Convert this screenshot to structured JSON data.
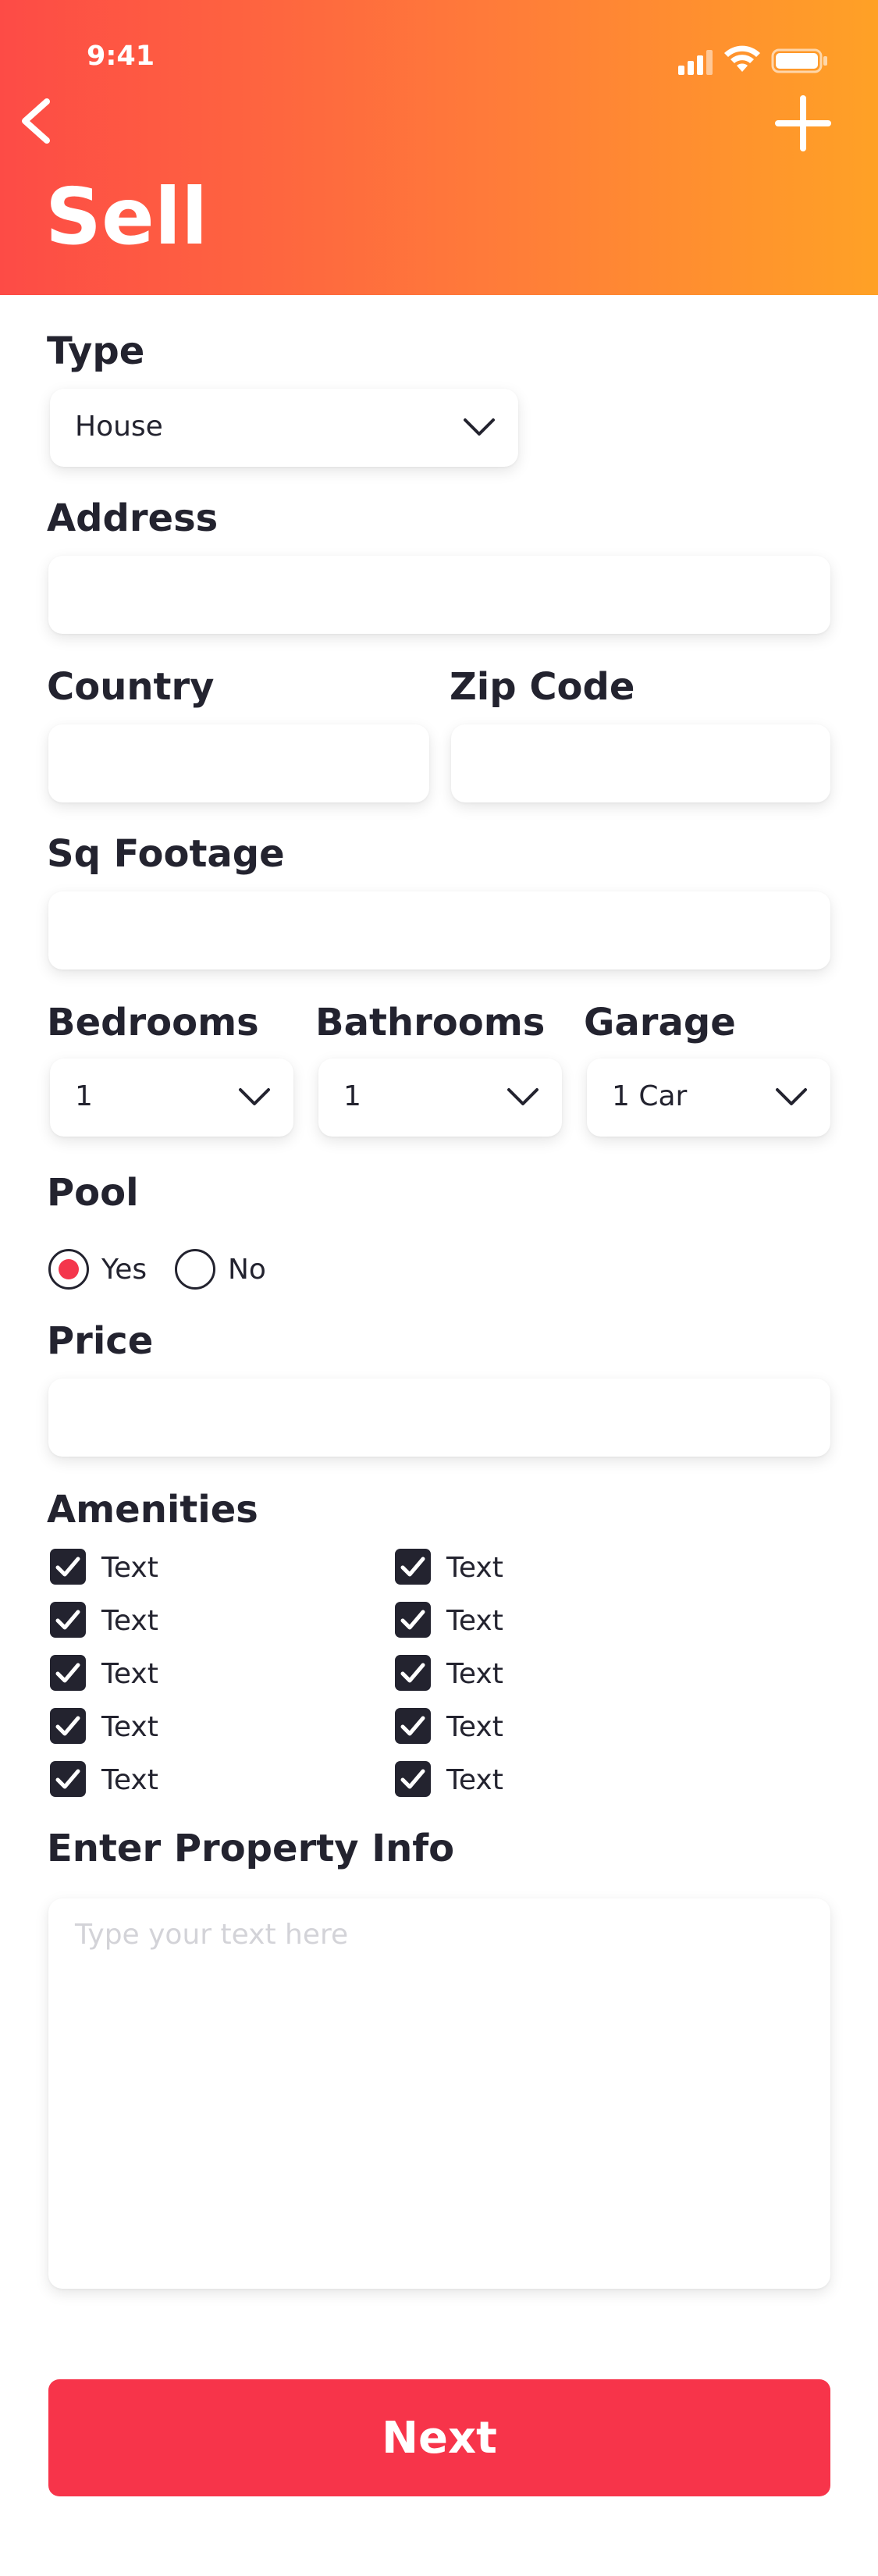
{
  "status_bar": {
    "time": "9:41"
  },
  "header": {
    "title": "Sell"
  },
  "form": {
    "type": {
      "label": "Type",
      "value": "House"
    },
    "address": {
      "label": "Address",
      "value": ""
    },
    "country": {
      "label": "Country",
      "value": ""
    },
    "zip": {
      "label": "Zip Code",
      "value": ""
    },
    "sq_footage": {
      "label": "Sq Footage",
      "value": ""
    },
    "bedrooms": {
      "label": "Bedrooms",
      "value": "1"
    },
    "bathrooms": {
      "label": "Bathrooms",
      "value": "1"
    },
    "garage": {
      "label": "Garage",
      "value": "1 Car"
    },
    "pool": {
      "label": "Pool",
      "options": [
        {
          "label": "Yes",
          "selected": true
        },
        {
          "label": "No",
          "selected": false
        }
      ]
    },
    "price": {
      "label": "Price",
      "value": ""
    },
    "amenities": {
      "label": "Amenities",
      "items": [
        "Text",
        "Text",
        "Text",
        "Text",
        "Text",
        "Text",
        "Text",
        "Text",
        "Text",
        "Text"
      ]
    },
    "property_info": {
      "label": "Enter Property Info",
      "placeholder": "Type your text here"
    }
  },
  "actions": {
    "next_label": "Next"
  },
  "colors": {
    "accent": "#f7344a",
    "gradient_start": "#fd4b46",
    "gradient_end": "#ffa126",
    "text": "#23232f"
  },
  "icons": {
    "back": "chevron-left-icon",
    "add": "plus-icon",
    "dropdown": "chevron-down-icon",
    "check": "checkmark-icon"
  }
}
